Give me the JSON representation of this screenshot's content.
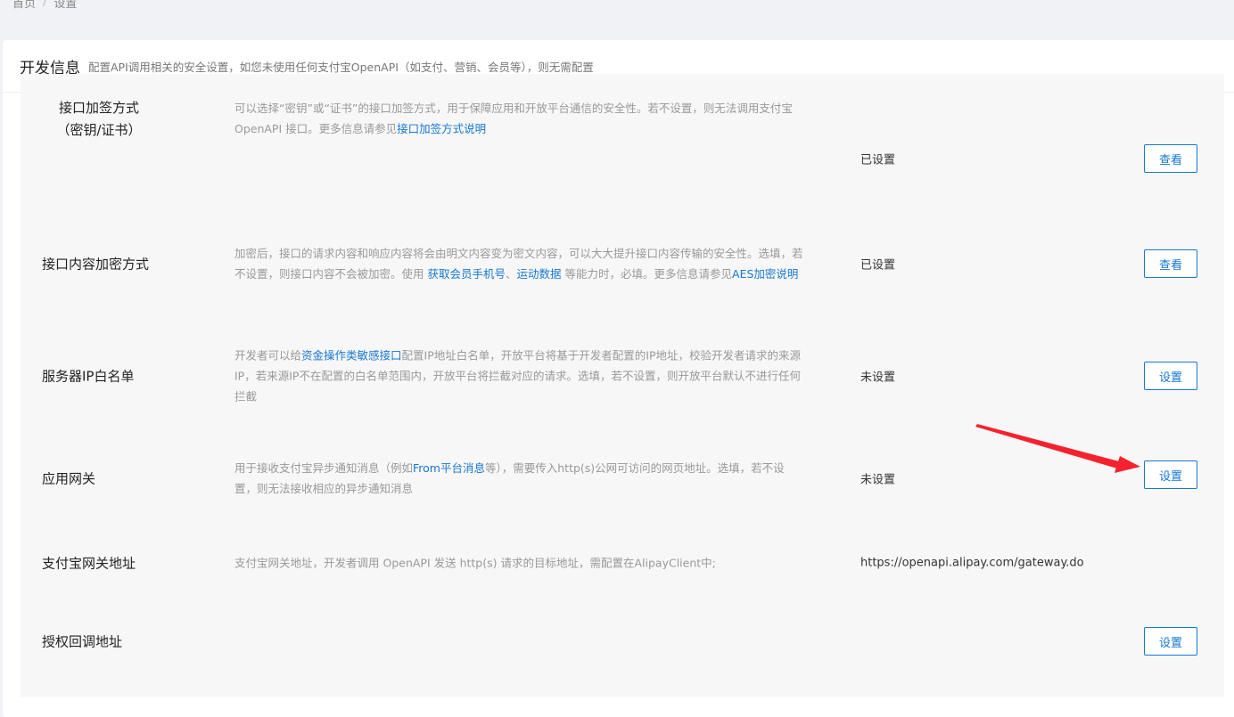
{
  "breadcrumb": [
    "首页",
    "设置"
  ],
  "breadcrumb_sep": "/",
  "header": {
    "title": "开发信息",
    "description": "配置API调用相关的安全设置，如您未使用任何支付宝OpenAPI（如支付、营销、会员等），则无需配置"
  },
  "rows": [
    {
      "label_lines": [
        "接口加签方式",
        "（密钥/证书）"
      ],
      "desc_parts": [
        {
          "text": "可以选择“密钥”或“证书”的接口加签方式，用于保障应用和开放平台通信的安全性。若不设置，则无法调用支付宝 OpenAPI 接口。更多信息请参见"
        },
        {
          "text": "接口加签方式说明",
          "link": true
        }
      ],
      "status": "已设置",
      "button": "查看"
    },
    {
      "label_lines": [
        "接口内容加密方式"
      ],
      "desc_parts": [
        {
          "text": "加密后，接口的请求内容和响应内容将会由明文内容变为密文内容，可以大大提升接口内容传输的安全性。选填，若不设置，则接口内容不会被加密。使用 "
        },
        {
          "text": "获取会员手机号",
          "link": true
        },
        {
          "text": "、"
        },
        {
          "text": "运动数据",
          "link": true
        },
        {
          "text": " 等能力时，必填。更多信息请参见"
        },
        {
          "text": "AES加密说明",
          "link": true
        }
      ],
      "status": "已设置",
      "button": "查看"
    },
    {
      "label_lines": [
        "服务器IP白名单"
      ],
      "desc_parts": [
        {
          "text": "开发者可以给"
        },
        {
          "text": "资金操作类敏感接口",
          "link": true
        },
        {
          "text": "配置IP地址白名单，开放平台将基于开发者配置的IP地址，校验开发者请求的来源IP，若来源IP不在配置的白名单范围内，开放平台将拦截对应的请求。选填，若不设置，则开放平台默认不进行任何拦截"
        }
      ],
      "status": "未设置",
      "button": "设置"
    },
    {
      "label_lines": [
        "应用网关"
      ],
      "desc_parts": [
        {
          "text": "用于接收支付宝异步通知消息（例如"
        },
        {
          "text": "From平台消息",
          "link": true
        },
        {
          "text": "等），需要传入http(s)公网可访问的网页地址。选填，若不设置，则无法接收相应的异步通知消息"
        }
      ],
      "status": "未设置",
      "button": "设置"
    },
    {
      "label_lines": [
        "支付宝网关地址"
      ],
      "desc_parts": [
        {
          "text": "支付宝网关地址，开发者调用 OpenAPI 发送 http(s) 请求的目标地址，需配置在AlipayClient中;"
        }
      ],
      "status": "https://openapi.alipay.com/gateway.do",
      "button": ""
    },
    {
      "label_lines": [
        "授权回调地址"
      ],
      "desc_parts": [],
      "status": "",
      "button": "设置"
    }
  ],
  "annotation": {
    "arrow_color": "#f5222d"
  }
}
